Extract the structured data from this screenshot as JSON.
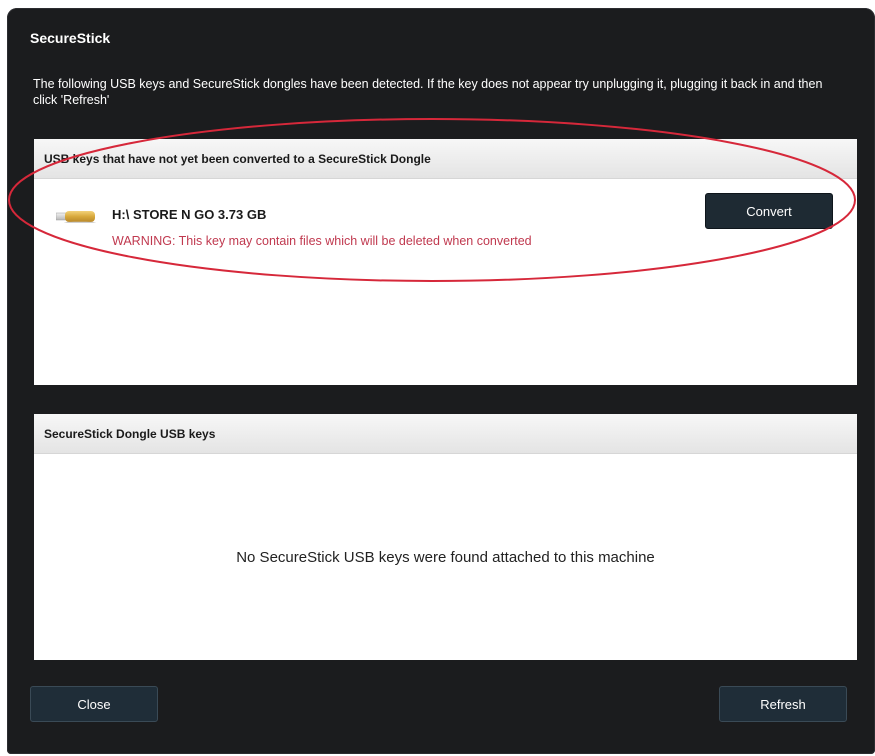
{
  "window": {
    "title": "SecureStick",
    "intro": "The following USB keys and SecureStick dongles have been detected.  If the key does not appear try unplugging it, plugging it back in and then click 'Refresh'"
  },
  "unconverted_panel": {
    "header": "USB keys that have not yet been converted to a SecureStick Dongle",
    "items": [
      {
        "icon": "usb-drive-icon",
        "name": "H:\\ STORE N GO 3.73 GB",
        "warning": "WARNING: This key may contain files which will be deleted when converted",
        "button_label": "Convert"
      }
    ]
  },
  "dongle_panel": {
    "header": "SecureStick Dongle USB keys",
    "empty_message": "No SecureStick USB keys were found attached to this machine"
  },
  "footer": {
    "close_label": "Close",
    "refresh_label": "Refresh"
  },
  "colors": {
    "window_bg": "#1b1c1e",
    "warning": "#c0394f",
    "annotation": "#d6283a",
    "button_bg": "#1e2a33"
  }
}
